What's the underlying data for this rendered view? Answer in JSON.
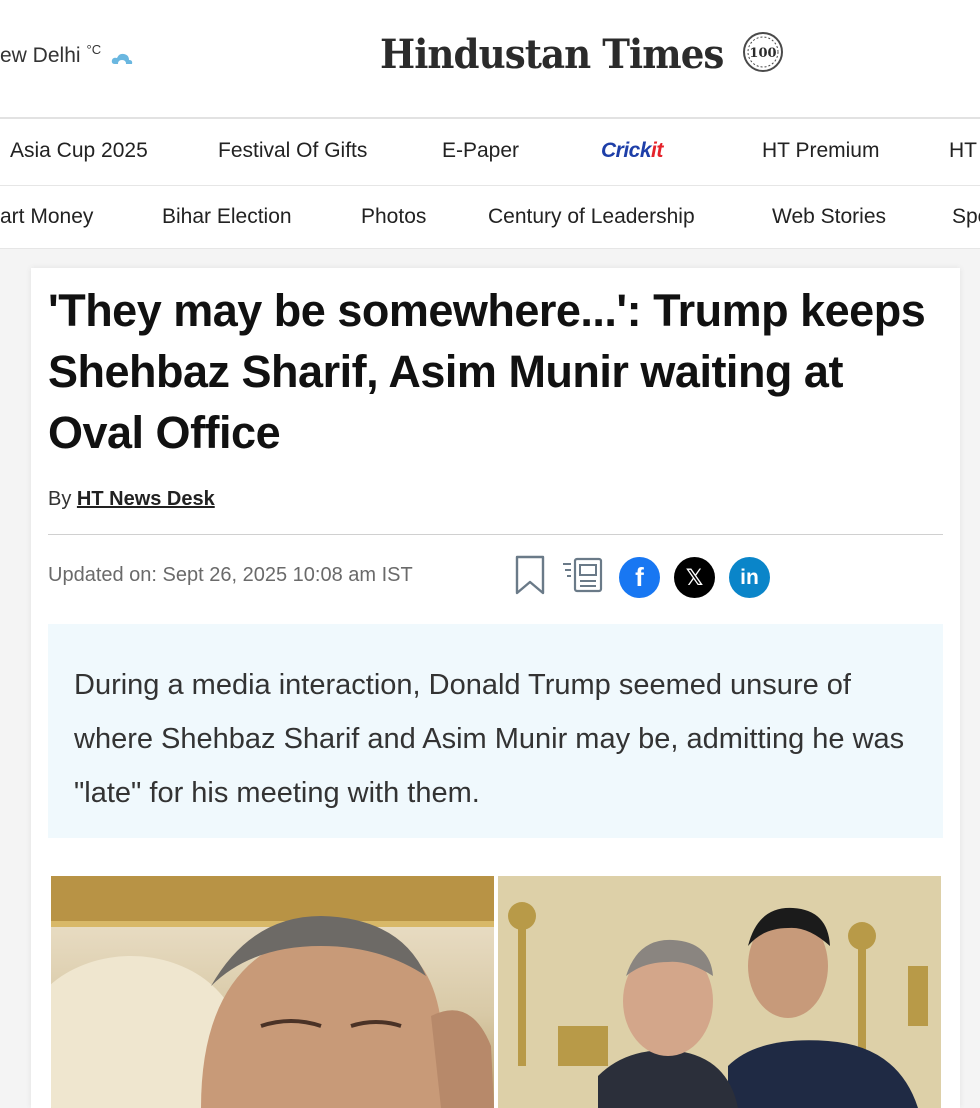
{
  "header": {
    "weather_city": "ew Delhi",
    "weather_unit": "°C",
    "logo_text": "Hindustan Times",
    "logo_badge": "100"
  },
  "nav_primary": [
    {
      "label": "Asia Cup 2025"
    },
    {
      "label": "Festival Of Gifts"
    },
    {
      "label": "E-Paper"
    },
    {
      "label": "Crick",
      "accent": "it",
      "brand_color": "#1d3ea8",
      "accent_color": "#e5222a"
    },
    {
      "label": "HT Premium"
    },
    {
      "label": "HT"
    }
  ],
  "nav_secondary": [
    {
      "label": "art Money"
    },
    {
      "label": "Bihar Election"
    },
    {
      "label": "Photos"
    },
    {
      "label": "Century of Leadership"
    },
    {
      "label": "Web Stories"
    },
    {
      "label": "Spo"
    }
  ],
  "article": {
    "headline": "'They may be somewhere...': Trump keeps Shehbaz Sharif, Asim Munir waiting at Oval Office",
    "by_prefix": "By",
    "author": "HT News Desk",
    "updated": "Updated on: Sept 26, 2025 10:08 am IST",
    "summary": "During a media interaction, Donald Trump seemed unsure of where Shehbaz Sharif and Asim Munir may be, admitting he was \"late\" for his meeting with them.",
    "share_icons": [
      "bookmark-icon",
      "reader-mode-icon",
      "facebook-icon",
      "x-icon",
      "linkedin-icon"
    ],
    "facebook_glyph": "f",
    "x_glyph": "𝕏",
    "linkedin_glyph": "in"
  },
  "colors": {
    "facebook": "#1877f2",
    "x": "#000000",
    "linkedin": "#0a85c9",
    "summary_bg": "#f0f9fd"
  }
}
